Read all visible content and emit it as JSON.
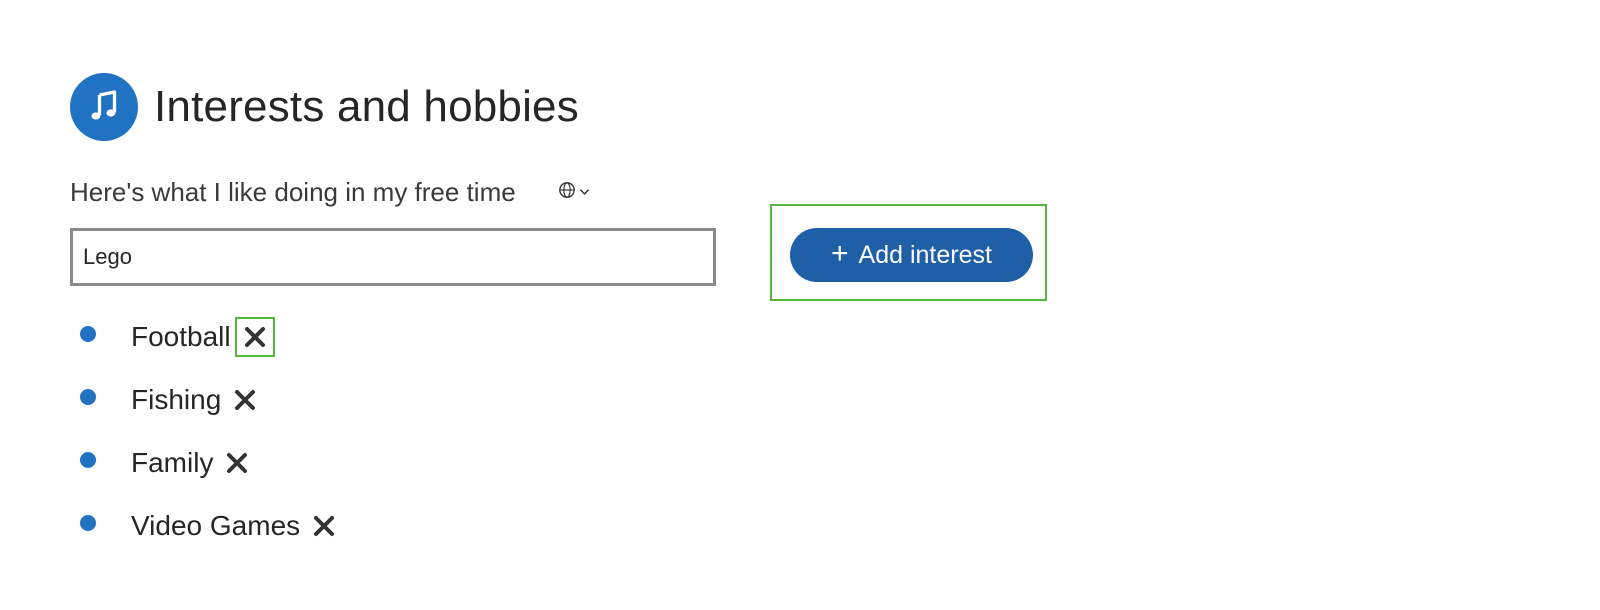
{
  "header": {
    "icon": "music-note-icon",
    "title": "Interests and hobbies",
    "accent_color": "#2272c3"
  },
  "subtitle": "Here's what I like doing in my free time",
  "visibility": {
    "icon": "globe-icon",
    "chevron": "chevron-down-icon"
  },
  "input": {
    "value": "Lego"
  },
  "add_button": {
    "icon": "plus-icon",
    "plus": "+",
    "label": "Add interest",
    "color": "#1e5fa8"
  },
  "interests": [
    {
      "label": "Football",
      "remove_icon": "close-icon"
    },
    {
      "label": "Fishing",
      "remove_icon": "close-icon"
    },
    {
      "label": "Family",
      "remove_icon": "close-icon"
    },
    {
      "label": "Video Games",
      "remove_icon": "close-icon"
    }
  ],
  "focus_color": "#55b53f"
}
